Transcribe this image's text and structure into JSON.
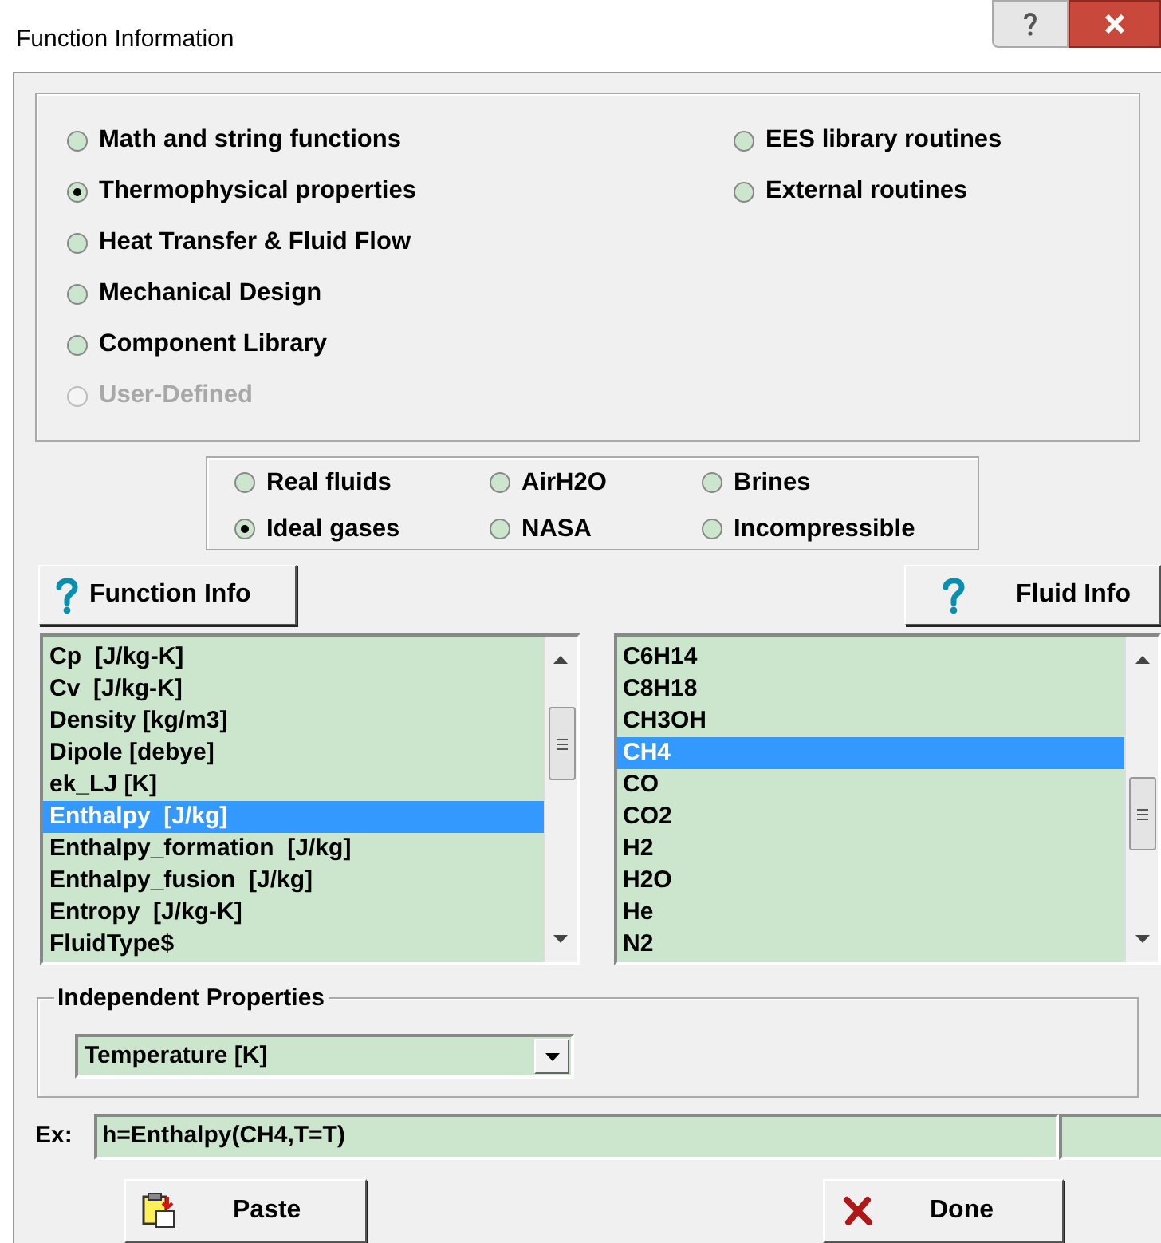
{
  "window": {
    "title": "Function Information"
  },
  "function_types": {
    "left": [
      {
        "label": "Math and string functions",
        "selected": false,
        "disabled": false
      },
      {
        "label": "Thermophysical properties",
        "selected": true,
        "disabled": false
      },
      {
        "label": "Heat Transfer & Fluid Flow",
        "selected": false,
        "disabled": false
      },
      {
        "label": "Mechanical Design",
        "selected": false,
        "disabled": false
      },
      {
        "label": "Component Library",
        "selected": false,
        "disabled": false
      },
      {
        "label": "User-Defined",
        "selected": false,
        "disabled": true
      }
    ],
    "right": [
      {
        "label": "EES library routines",
        "selected": false,
        "disabled": false
      },
      {
        "label": "External routines",
        "selected": false,
        "disabled": false
      }
    ]
  },
  "fluid_types": [
    {
      "label": "Real fluids",
      "selected": false
    },
    {
      "label": "AirH2O",
      "selected": false
    },
    {
      "label": "Brines",
      "selected": false
    },
    {
      "label": "Ideal gases",
      "selected": true
    },
    {
      "label": "NASA",
      "selected": false
    },
    {
      "label": "Incompressible",
      "selected": false
    }
  ],
  "buttons": {
    "function_info": "Function Info",
    "fluid_info": "Fluid Info",
    "paste": "Paste",
    "done": "Done"
  },
  "functions": [
    {
      "label": "Cp  [J/kg-K]",
      "selected": false
    },
    {
      "label": "Cv  [J/kg-K]",
      "selected": false
    },
    {
      "label": "Density [kg/m3]",
      "selected": false
    },
    {
      "label": "Dipole [debye]",
      "selected": false
    },
    {
      "label": "ek_LJ [K]",
      "selected": false
    },
    {
      "label": "Enthalpy  [J/kg]",
      "selected": true
    },
    {
      "label": "Enthalpy_formation  [J/kg]",
      "selected": false
    },
    {
      "label": "Enthalpy_fusion  [J/kg]",
      "selected": false
    },
    {
      "label": "Entropy  [J/kg-K]",
      "selected": false
    },
    {
      "label": "FluidType$",
      "selected": false
    }
  ],
  "fluids": [
    {
      "label": "C6H14",
      "selected": false
    },
    {
      "label": "C8H18",
      "selected": false
    },
    {
      "label": "CH3OH",
      "selected": false
    },
    {
      "label": "CH4",
      "selected": true
    },
    {
      "label": "CO",
      "selected": false
    },
    {
      "label": "CO2",
      "selected": false
    },
    {
      "label": "H2",
      "selected": false
    },
    {
      "label": "H2O",
      "selected": false
    },
    {
      "label": "He",
      "selected": false
    },
    {
      "label": "N2",
      "selected": false
    }
  ],
  "independent_properties": {
    "title": "Independent Properties",
    "value": "Temperature [K]"
  },
  "example": {
    "label": "Ex:",
    "value": "h=Enthalpy(CH4,T=T)"
  }
}
